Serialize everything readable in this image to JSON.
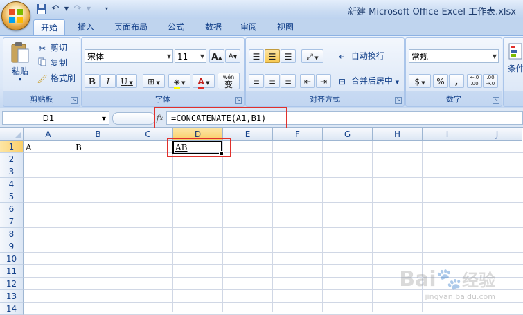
{
  "window": {
    "title": "新建 Microsoft Office Excel 工作表.xlsx"
  },
  "tabs": [
    "开始",
    "插入",
    "页面布局",
    "公式",
    "数据",
    "审阅",
    "视图"
  ],
  "clipboard": {
    "paste": "粘贴",
    "cut": "剪切",
    "copy": "复制",
    "format_painter": "格式刷",
    "label": "剪贴板"
  },
  "font": {
    "name": "宋体",
    "size": "11",
    "bold": "B",
    "italic": "I",
    "underline": "U",
    "label": "字体",
    "grow": "A",
    "shrink": "A",
    "phonetic": "wén",
    "phonetic_char": "变",
    "font_color_letter": "A"
  },
  "alignment": {
    "wrap": "自动换行",
    "merge": "合并后居中",
    "label": "对齐方式"
  },
  "number": {
    "format": "常规",
    "label": "数字",
    "percent": "%",
    "comma": ",",
    "inc": "←.0 .00",
    "dec": ".00 →.0"
  },
  "styles": {
    "conditional": "条件"
  },
  "formula_bar": {
    "name_box": "D1",
    "fx": "fx",
    "formula": "=CONCATENATE(A1,B1)"
  },
  "columns": [
    "A",
    "B",
    "C",
    "D",
    "E",
    "F",
    "G",
    "H",
    "I",
    "J"
  ],
  "rows": [
    "1",
    "2",
    "3",
    "4",
    "5",
    "6",
    "7",
    "8",
    "9",
    "10",
    "11",
    "12",
    "13",
    "14"
  ],
  "cells": {
    "A1": "A",
    "B1": "B",
    "D1": "AB"
  },
  "watermark": {
    "brand": "Bai",
    "brand2": "经验",
    "url": "jingyan.baidu.com"
  },
  "colors": {
    "selection_header": "#f9cf6a",
    "highlight_box": "#e0302c",
    "ribbon": "#dbe7f7"
  }
}
